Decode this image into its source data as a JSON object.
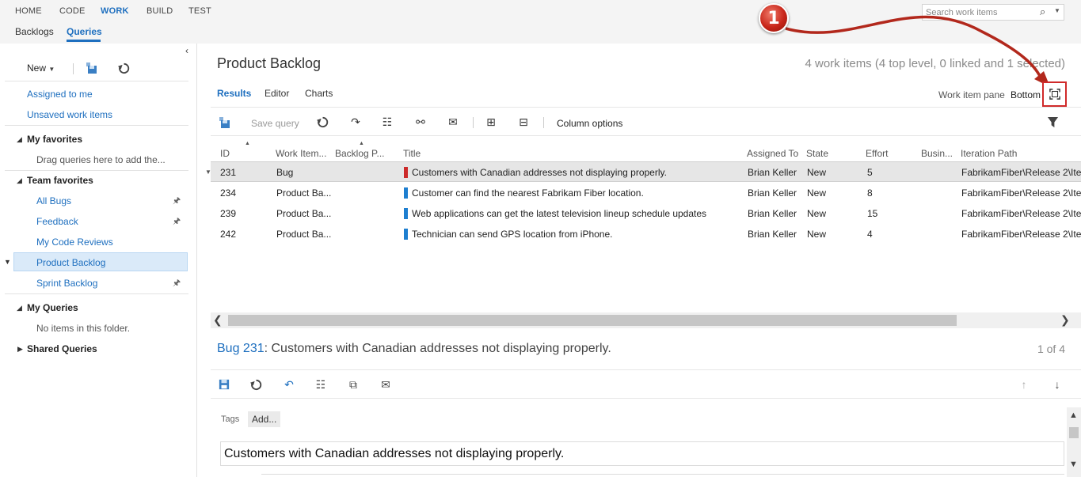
{
  "top_nav": [
    "HOME",
    "CODE",
    "WORK",
    "BUILD",
    "TEST"
  ],
  "sub_nav": [
    "Backlogs",
    "Queries"
  ],
  "search": {
    "placeholder": "Search work items"
  },
  "callout": {
    "number": "1"
  },
  "sidebar": {
    "new_label": "New",
    "assigned_to_me": "Assigned to me",
    "unsaved_work_items": "Unsaved work items",
    "my_favorites": "My favorites",
    "drag_hint": "Drag queries here to add the...",
    "team_favorites": "Team favorites",
    "team_items": [
      "All Bugs",
      "Feedback",
      "My Code Reviews",
      "Product Backlog",
      "Sprint Backlog"
    ],
    "my_queries": "My Queries",
    "no_items": "No items in this folder.",
    "shared_queries": "Shared Queries"
  },
  "main": {
    "title": "Product Backlog",
    "summary": "4 work items (4 top level, 0 linked and 1 selected)",
    "tabs": [
      "Results",
      "Editor",
      "Charts"
    ],
    "work_item_pane_label": "Work item pane",
    "work_item_pane_value": "Bottom",
    "toolbar": {
      "save_query": "Save query",
      "column_options": "Column options"
    },
    "columns": [
      "ID",
      "Work Item...",
      "Backlog P...",
      "Title",
      "Assigned To",
      "State",
      "Effort",
      "Busin...",
      "Iteration Path"
    ],
    "rows": [
      {
        "id": "231",
        "type": "Bug",
        "title": "Customers with Canadian addresses not displaying properly.",
        "assigned": "Brian Keller",
        "state": "New",
        "effort": "5",
        "iteration": "FabrikamFiber\\Release 2\\Iter",
        "color": "#cc2a2a"
      },
      {
        "id": "234",
        "type": "Product Ba...",
        "title": "Customer can find the nearest Fabrikam Fiber location.",
        "assigned": "Brian Keller",
        "state": "New",
        "effort": "8",
        "iteration": "FabrikamFiber\\Release 2\\Iter",
        "color": "#1e7fd0"
      },
      {
        "id": "239",
        "type": "Product Ba...",
        "title": "Web applications can get the latest television lineup schedule updates",
        "assigned": "Brian Keller",
        "state": "New",
        "effort": "15",
        "iteration": "FabrikamFiber\\Release 2\\Iter",
        "color": "#1e7fd0"
      },
      {
        "id": "242",
        "type": "Product Ba...",
        "title": "Technician can send GPS location from iPhone.",
        "assigned": "Brian Keller",
        "state": "New",
        "effort": "4",
        "iteration": "FabrikamFiber\\Release 2\\Iter",
        "color": "#1e7fd0"
      }
    ]
  },
  "detail": {
    "bug_link": "Bug 231",
    "title_text": "Customers with Canadian addresses not displaying properly.",
    "counter": "1 of 4",
    "tags_label": "Tags",
    "add_label": "Add...",
    "title_field": "Customers with Canadian addresses not displaying properly."
  },
  "colors": {
    "accent": "#1e6fbf",
    "bug": "#cc2a2a",
    "pbi": "#1e7fd0",
    "annotation": "#c8261a"
  }
}
